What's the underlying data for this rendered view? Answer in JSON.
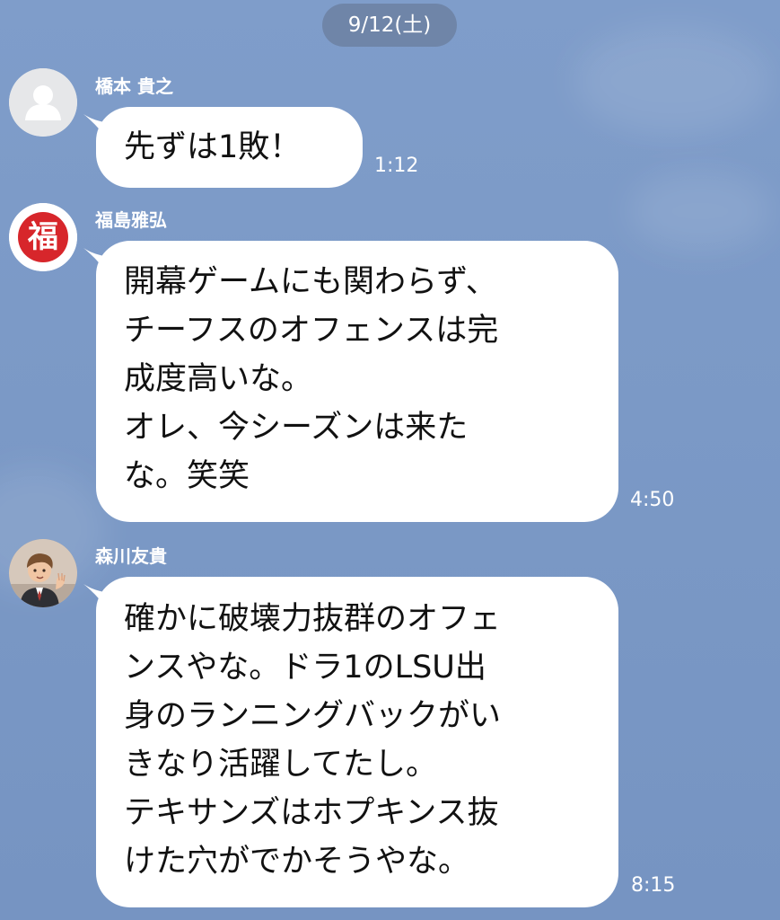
{
  "date_header": "9/12(土)",
  "messages": [
    {
      "sender": "橋本 貴之",
      "avatar": "default-user-icon",
      "text": "先ずは1敗！",
      "time": "1:12"
    },
    {
      "sender": "福島雅弘",
      "avatar": "fuku-kanji-icon",
      "avatar_glyph": "福",
      "text": "開幕ゲームにも関わらず、\nチーフスのオフェンスは完\n成度高いな。\nオレ、今シーズンは来た\nな。笑笑",
      "time": "4:50"
    },
    {
      "sender": "森川友貴",
      "avatar": "illustrated-person-icon",
      "text": "確かに破壊力抜群のオフェ\nンスやな。ドラ1のLSU出\n身のランニングバックがい\nきなり活躍してたし。\nテキサンズはホプキンス抜\nけた穴がでかそうやな。",
      "time": "8:15"
    }
  ],
  "colors": {
    "background": "#7d9bc8",
    "date_pill": "#6f85a8",
    "bubble": "#ffffff",
    "text": "#111111",
    "fuku_red": "#d7262b"
  }
}
